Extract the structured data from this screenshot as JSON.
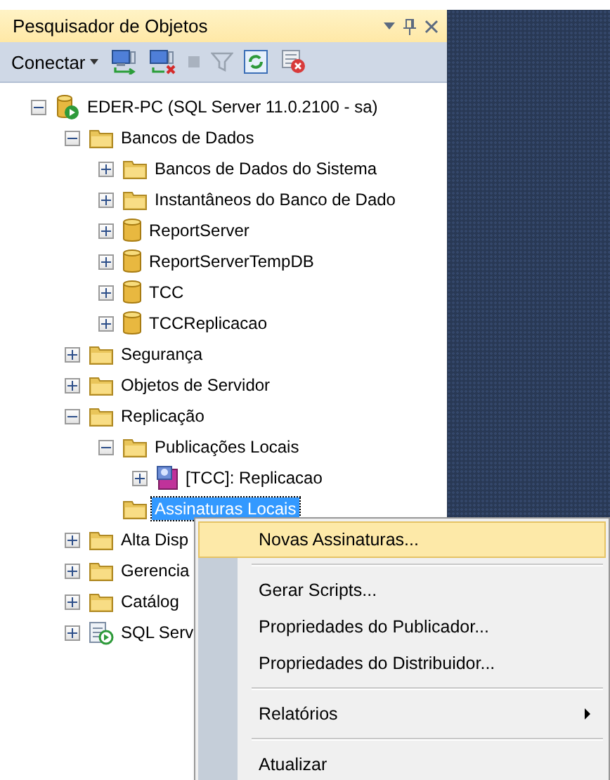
{
  "panel": {
    "title": "Pesquisador de Objetos"
  },
  "toolbar": {
    "connect_label": "Conectar"
  },
  "tree": [
    {
      "label": "EDER-PC (SQL Server 11.0.2100 - sa)",
      "kind": "server",
      "expanded": true,
      "selected": false,
      "children": [
        {
          "label": "Bancos de Dados",
          "kind": "folder",
          "expanded": true,
          "selected": false,
          "children": [
            {
              "label": "Bancos de Dados do Sistema",
              "kind": "folder",
              "expanded": false,
              "selected": false
            },
            {
              "label": "Instantâneos do Banco de Dado",
              "kind": "folder",
              "expanded": false,
              "selected": false
            },
            {
              "label": "ReportServer",
              "kind": "database",
              "expanded": false,
              "selected": false
            },
            {
              "label": "ReportServerTempDB",
              "kind": "database",
              "expanded": false,
              "selected": false
            },
            {
              "label": "TCC",
              "kind": "database",
              "expanded": false,
              "selected": false
            },
            {
              "label": "TCCReplicacao",
              "kind": "database",
              "expanded": false,
              "selected": false
            }
          ]
        },
        {
          "label": "Segurança",
          "kind": "folder",
          "expanded": false,
          "selected": false
        },
        {
          "label": "Objetos de Servidor",
          "kind": "folder",
          "expanded": false,
          "selected": false
        },
        {
          "label": "Replicação",
          "kind": "folder",
          "expanded": true,
          "selected": false,
          "children": [
            {
              "label": "Publicações Locais",
              "kind": "folder",
              "expanded": true,
              "selected": false,
              "children": [
                {
                  "label": "[TCC]: Replicacao",
                  "kind": "publication",
                  "expanded": false,
                  "selected": false
                }
              ]
            },
            {
              "label": "Assinaturas Locais",
              "kind": "folder",
              "leaf": true,
              "selected": true
            }
          ]
        },
        {
          "label": "Alta Disp",
          "kind": "folder",
          "expanded": false,
          "selected": false
        },
        {
          "label": "Gerencia",
          "kind": "folder",
          "expanded": false,
          "selected": false
        },
        {
          "label": "Catálog",
          "kind": "folder",
          "expanded": false,
          "selected": false
        },
        {
          "label": "SQL Serv",
          "kind": "agent",
          "expanded": false,
          "selected": false
        }
      ]
    }
  ],
  "context_menu": [
    {
      "kind": "item",
      "label": "Novas Assinaturas...",
      "highlighted": true
    },
    {
      "kind": "separator"
    },
    {
      "kind": "item",
      "label": "Gerar Scripts...",
      "highlighted": false
    },
    {
      "kind": "item",
      "label": "Propriedades do Publicador...",
      "highlighted": false
    },
    {
      "kind": "item",
      "label": "Propriedades do Distribuidor...",
      "highlighted": false
    },
    {
      "kind": "separator"
    },
    {
      "kind": "item",
      "label": "Relatórios",
      "highlighted": false,
      "submenu": true
    },
    {
      "kind": "separator"
    },
    {
      "kind": "item",
      "label": "Atualizar",
      "highlighted": false
    }
  ]
}
